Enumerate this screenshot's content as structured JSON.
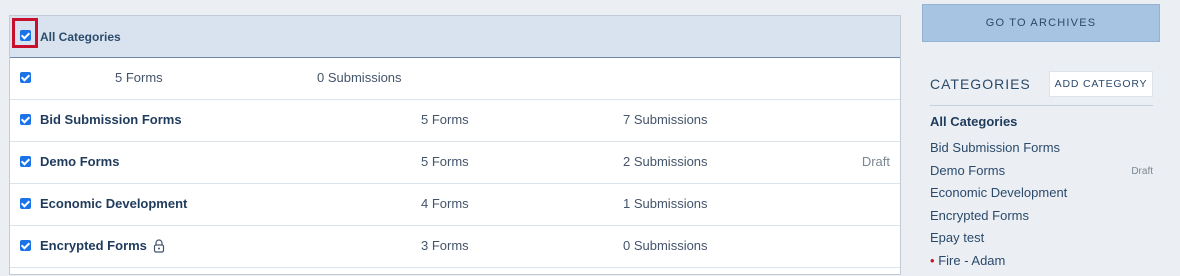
{
  "main": {
    "header": {
      "label": "All Categories",
      "checked": true
    },
    "rows": [
      {
        "name": "",
        "forms": "5  Forms",
        "submissions": "0  Submissions",
        "status": "",
        "locked": false
      },
      {
        "name": "Bid Submission Forms",
        "forms": "5  Forms",
        "submissions": "7  Submissions",
        "status": "",
        "locked": false
      },
      {
        "name": "Demo Forms",
        "forms": "5  Forms",
        "submissions": "2  Submissions",
        "status": "Draft",
        "locked": false
      },
      {
        "name": "Economic Development",
        "forms": "4  Forms",
        "submissions": "1  Submissions",
        "status": "",
        "locked": false
      },
      {
        "name": "Encrypted Forms",
        "forms": "3  Forms",
        "submissions": "0  Submissions",
        "status": "",
        "locked": true
      }
    ]
  },
  "sidebar": {
    "archives_button": "GO TO ARCHIVES",
    "categories_title": "CATEGORIES",
    "add_category_button": "ADD CATEGORY",
    "categories": [
      {
        "label": "All Categories",
        "active": true,
        "status": ""
      },
      {
        "label": "Bid Submission Forms",
        "active": false,
        "status": ""
      },
      {
        "label": "Demo Forms",
        "active": false,
        "status": "Draft"
      },
      {
        "label": "Economic Development",
        "active": false,
        "status": ""
      },
      {
        "label": "Encrypted Forms",
        "active": false,
        "status": ""
      },
      {
        "label": "Epay test",
        "active": false,
        "status": ""
      },
      {
        "label": "Fire - Adam",
        "active": false,
        "status": "",
        "marker": "•"
      }
    ]
  },
  "colors": {
    "accent": "#1a73e8",
    "highlight": "#c8102e",
    "header_bg": "#d9e3ef",
    "button_bg": "#a7c4e2"
  }
}
